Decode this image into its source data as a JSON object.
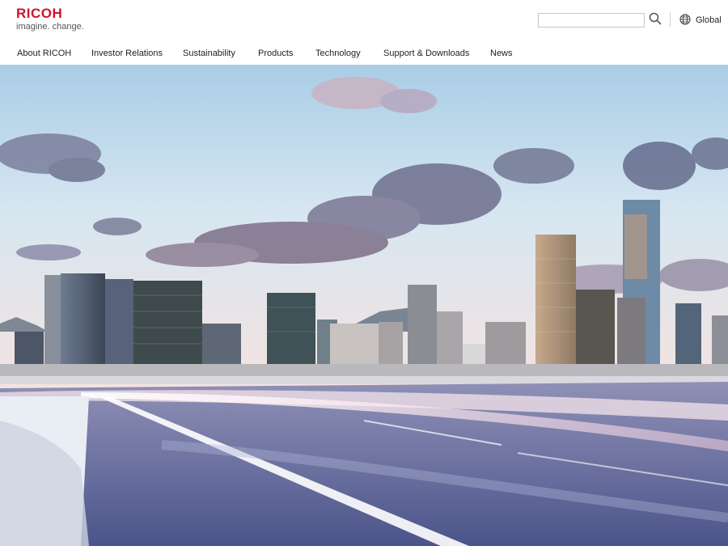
{
  "brand": {
    "name": "RICOH",
    "tagline": "imagine. change.",
    "accent": "#cf142b"
  },
  "search": {
    "value": "",
    "placeholder": "",
    "icon": "search-icon"
  },
  "region": {
    "label": "Global",
    "icon": "globe-icon"
  },
  "nav": {
    "items": [
      {
        "label": "About RICOH"
      },
      {
        "label": "Investor Relations"
      },
      {
        "label": "Sustainability"
      },
      {
        "label": "Products"
      },
      {
        "label": "Technology"
      },
      {
        "label": "Support & Downloads"
      },
      {
        "label": "News"
      }
    ]
  },
  "hero": {
    "image": "city-skyline-highway-photo",
    "colors": {
      "sky_top": "#bcd7ea",
      "sky_bottom": "#f3e6e3",
      "road": "#6a6f9a"
    }
  }
}
